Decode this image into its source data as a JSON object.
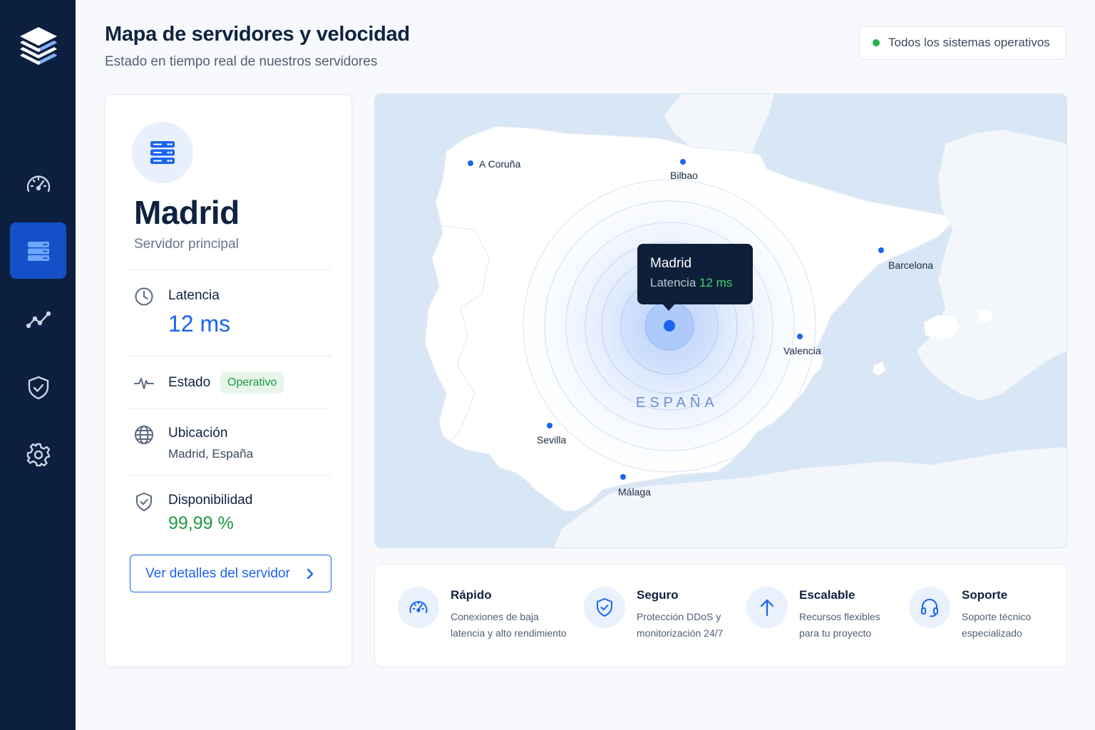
{
  "header": {
    "title": "Mapa de servidores y velocidad",
    "subtitle": "Estado en tiempo real de nuestros servidores",
    "status": "Todos los sistemas operativos"
  },
  "sidebar": {
    "items": [
      {
        "icon": "speedometer-icon",
        "active": false
      },
      {
        "icon": "server-icon",
        "active": true
      },
      {
        "icon": "analytics-icon",
        "active": false
      },
      {
        "icon": "shield-check-icon",
        "active": false
      },
      {
        "icon": "gear-icon",
        "active": false
      }
    ]
  },
  "server": {
    "name": "Madrid",
    "role": "Servidor principal",
    "latency_label": "Latencia",
    "latency_value": "12 ms",
    "status_label": "Estado",
    "status_badge": "Operativo",
    "location_label": "Ubicación",
    "location_value": "Madrid, España",
    "uptime_label": "Disponibilidad",
    "uptime_value": "99,99 %",
    "details_button": "Ver detalles del servidor"
  },
  "map": {
    "country": "ESPAÑA",
    "cities": {
      "coruna": "A Coruña",
      "bilbao": "Bilbao",
      "barcelona": "Barcelona",
      "valencia": "Valencia",
      "sevilla": "Sevilla",
      "malaga": "Málaga"
    },
    "tooltip": {
      "city": "Madrid",
      "latency_label": "Latencia",
      "latency_value": "12 ms"
    }
  },
  "features": [
    {
      "title": "Rápido",
      "desc_1": "Conexiones de baja",
      "desc_2": "latencia y alto rendimiento"
    },
    {
      "title": "Seguro",
      "desc_1": "Protección DDoS y",
      "desc_2": "monitorización 24/7"
    },
    {
      "title": "Escalable",
      "desc_1": "Recursos flexibles",
      "desc_2": "para tu proyecto"
    },
    {
      "title": "Soporte",
      "desc_1": "Soporte técnico",
      "desc_2": "especializado"
    }
  ],
  "colors": {
    "sidebar": "#0c1f3f",
    "accent": "#1a64f0",
    "success": "#22b14c",
    "sea": "#d9e6f5"
  }
}
